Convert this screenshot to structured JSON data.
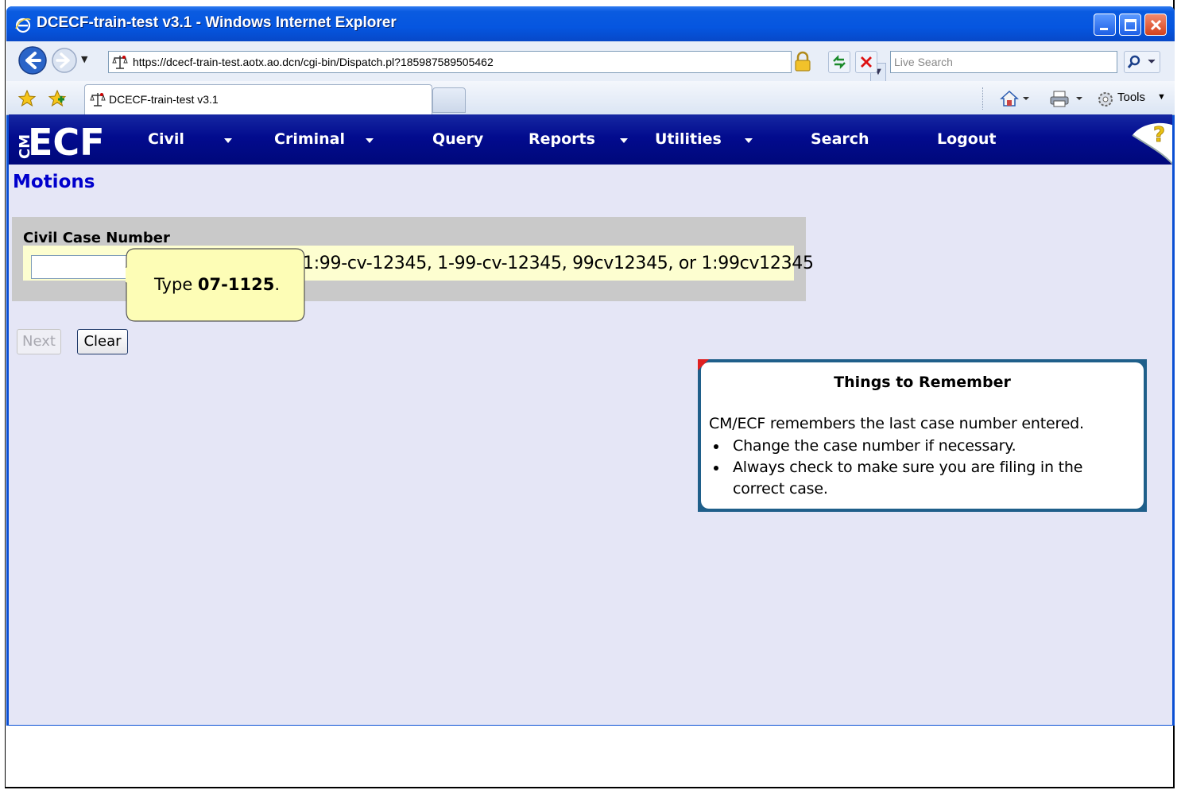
{
  "window": {
    "title": "DCECF-train-test v3.1 - Windows Internet Explorer"
  },
  "address": {
    "url": "https://dcecf-train-test.aotx.ao.dcn/cgi-bin/Dispatch.pl?185987589505462",
    "search_placeholder": "Live Search"
  },
  "tabs": [
    {
      "label": "DCECF-train-test v3.1"
    }
  ],
  "commandbar": {
    "tools_label": "Tools"
  },
  "ecf": {
    "menu": [
      {
        "label": "Civil",
        "has_dropdown": true
      },
      {
        "label": "Criminal",
        "has_dropdown": true
      },
      {
        "label": "Query",
        "has_dropdown": false
      },
      {
        "label": "Reports",
        "has_dropdown": true
      },
      {
        "label": "Utilities",
        "has_dropdown": true
      },
      {
        "label": "Search",
        "has_dropdown": false
      },
      {
        "label": "Logout",
        "has_dropdown": false
      }
    ],
    "colors": {
      "menubar": "#020b8e",
      "page_background": "#e5e6f6",
      "title": "#0000cc"
    }
  },
  "page": {
    "title": "Motions",
    "case_number_label": "Civil Case Number",
    "case_number_value": "",
    "case_number_hint": "1:99-cv-12345, 1-99-cv-12345, 99cv12345, or 1:99cv12345",
    "buttons": {
      "next": "Next",
      "clear": "Clear"
    }
  },
  "tooltip": {
    "prefix": "Type ",
    "value": "07-1125",
    "suffix": "."
  },
  "remember": {
    "title": "Things to Remember",
    "intro": "CM/ECF remembers the last case number entered.",
    "items": [
      "Change the case number if necessary.",
      "Always check to make sure you are filing in the correct case."
    ]
  }
}
